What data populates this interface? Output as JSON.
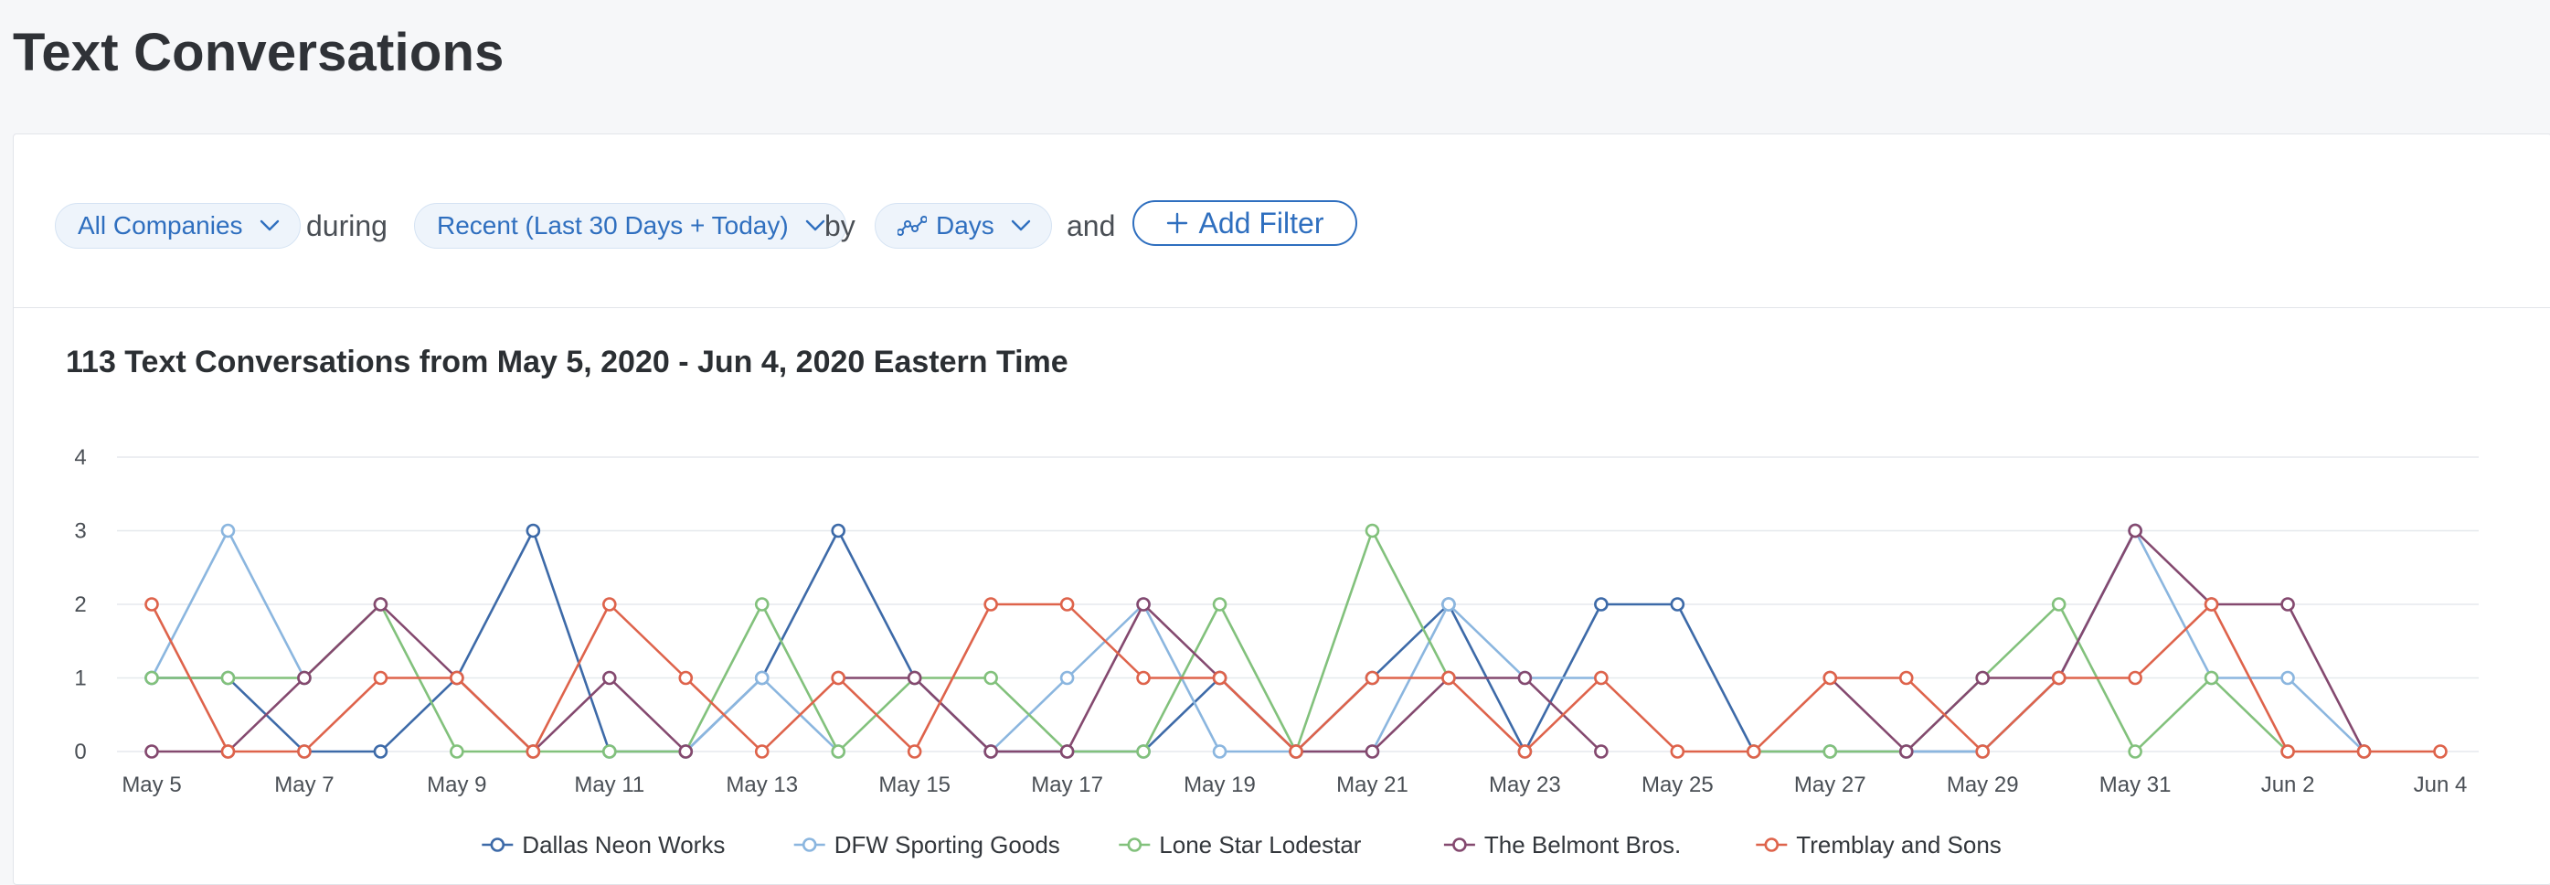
{
  "page": {
    "title": "Text Conversations"
  },
  "filters": {
    "company": "All Companies",
    "during_word": "during",
    "range": "Recent (Last 30 Days + Today)",
    "by_word": "by",
    "granularity": "Days",
    "and_word": "and",
    "add_filter": "Add Filter"
  },
  "icons": {
    "dropdown": "chevron-down-icon",
    "granularity": "line-chart-icon",
    "add": "plus-icon"
  },
  "chart_data": {
    "type": "line",
    "title": "113 Text Conversations from May 5, 2020 - Jun 4, 2020 Eastern Time",
    "xlabel": "",
    "ylabel": "",
    "ylim": [
      0,
      4
    ],
    "yticks": [
      0,
      1,
      2,
      3,
      4
    ],
    "grid": true,
    "legend_position": "bottom",
    "x": [
      "May 5",
      "May 6",
      "May 7",
      "May 8",
      "May 9",
      "May 10",
      "May 11",
      "May 12",
      "May 13",
      "May 14",
      "May 15",
      "May 16",
      "May 17",
      "May 18",
      "May 19",
      "May 20",
      "May 21",
      "May 22",
      "May 23",
      "May 24",
      "May 25",
      "May 26",
      "May 27",
      "May 28",
      "May 29",
      "May 30",
      "May 31",
      "Jun 1",
      "Jun 2",
      "Jun 3",
      "Jun 4"
    ],
    "xtick_labels": [
      "May 5",
      "May 7",
      "May 9",
      "May 11",
      "May 13",
      "May 15",
      "May 17",
      "May 19",
      "May 21",
      "May 23",
      "May 25",
      "May 27",
      "May 29",
      "May 31",
      "Jun 2",
      "Jun 4"
    ],
    "series": [
      {
        "name": "Dallas Neon Works",
        "color": "#3d6aa8",
        "values": [
          1,
          1,
          0,
          0,
          1,
          3,
          0,
          0,
          1,
          3,
          1,
          0,
          0,
          0,
          1,
          0,
          1,
          2,
          0,
          2,
          2,
          0,
          0,
          0,
          0,
          1,
          3,
          null,
          null,
          null,
          null
        ]
      },
      {
        "name": "DFW Sporting Goods",
        "color": "#8bb6df",
        "values": [
          1,
          3,
          1,
          null,
          null,
          null,
          null,
          0,
          1,
          0,
          null,
          0,
          1,
          2,
          0,
          0,
          0,
          2,
          1,
          1,
          null,
          null,
          null,
          0,
          0,
          1,
          3,
          1,
          1,
          0,
          null
        ]
      },
      {
        "name": "Lone Star Lodestar",
        "color": "#82c17c",
        "values": [
          1,
          1,
          1,
          2,
          0,
          0,
          0,
          0,
          2,
          0,
          1,
          1,
          0,
          0,
          2,
          0,
          3,
          1,
          null,
          null,
          null,
          0,
          0,
          0,
          1,
          2,
          0,
          1,
          0,
          null,
          null
        ]
      },
      {
        "name": "The Belmont Bros.",
        "color": "#84496f",
        "values": [
          0,
          0,
          1,
          2,
          1,
          0,
          1,
          0,
          null,
          1,
          1,
          0,
          0,
          2,
          1,
          0,
          0,
          1,
          1,
          0,
          null,
          null,
          1,
          0,
          1,
          1,
          3,
          2,
          2,
          0,
          null
        ]
      },
      {
        "name": "Tremblay and Sons",
        "color": "#de634b",
        "values": [
          2,
          0,
          0,
          1,
          1,
          0,
          2,
          1,
          0,
          1,
          0,
          2,
          2,
          1,
          1,
          0,
          1,
          1,
          0,
          1,
          0,
          0,
          1,
          1,
          0,
          1,
          1,
          2,
          0,
          0,
          0
        ]
      }
    ]
  }
}
